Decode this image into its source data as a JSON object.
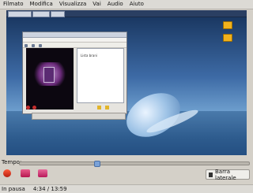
{
  "menu": {
    "items": [
      "Filmato",
      "Modifica",
      "Visualizza",
      "Vai",
      "Audio",
      "Aiuto"
    ]
  },
  "video": {
    "desktop": {
      "taskbar_items": [
        "Applicazioni",
        "Risorse",
        "Azioni"
      ],
      "clock": "",
      "icons": [
        "folder-icon",
        "folder-icon"
      ]
    },
    "app_window": {
      "list_item": "Lista brani"
    }
  },
  "seek": {
    "label": "Tempo:",
    "position_fraction": 0.33
  },
  "controls": {
    "prev": "previous-icon",
    "play": "play-icon",
    "next": "next-icon",
    "volume": "volume-icon",
    "sidebar_label": "Barra laterale"
  },
  "status": {
    "state": "In pausa",
    "time": "4:34 / 13:59"
  }
}
